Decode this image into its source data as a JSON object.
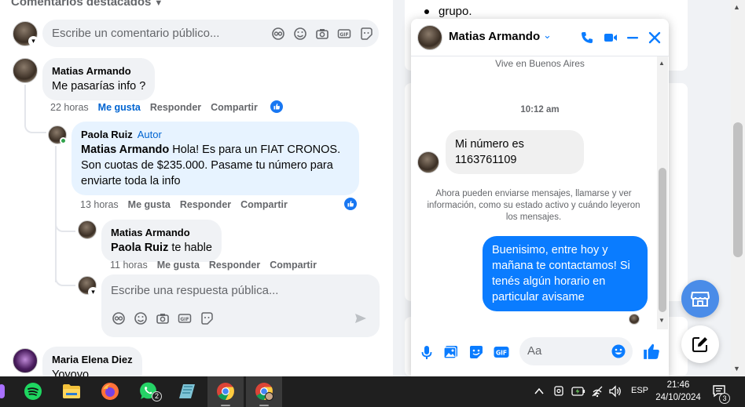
{
  "post": {
    "filter_label": "Comentarios destacados",
    "comment_input_placeholder": "Escribe un comentario público...",
    "reply_input_placeholder": "Escribe una respuesta pública..."
  },
  "comments": [
    {
      "author": "Matias Armando",
      "text": "Me pasarías info ?",
      "time": "22 horas",
      "like": "Me gusta",
      "reply": "Responder",
      "share": "Compartir"
    },
    {
      "author": "Paola Ruiz",
      "badge": "Autor",
      "mention": "Matias Armando",
      "text": " Hola! Es para un FIAT CRONOS. Son cuotas de $235.000. Pasame tu número para enviarte toda la info",
      "time": "13 horas",
      "like": "Me gusta",
      "reply": "Responder",
      "share": "Compartir"
    },
    {
      "author": "Matias Armando",
      "mention": "Paola Ruiz",
      "text": " te hable",
      "time": "11 horas",
      "like": "Me gusta",
      "reply": "Responder",
      "share": "Compartir"
    },
    {
      "author": "Maria Elena Diez",
      "text": "Yoyoyo"
    }
  ],
  "background_card": {
    "text": "grupo."
  },
  "chat": {
    "contact_name": "Matias Armando",
    "location": "Vive en Buenos Aires",
    "timestamp": "10:12 am",
    "incoming_message": "Mi número es 1163761109",
    "system_notice": "Ahora pueden enviarse mensajes, llamarse y ver información, como su estado activo y cuándo leyeron los mensajes.",
    "outgoing_message": "Buenisimo, entre hoy y mañana te contactamos! Si tenés algún horario en particular avisame",
    "input_placeholder": "Aa"
  },
  "taskbar": {
    "apps": [
      "spotify",
      "file-explorer",
      "firefox",
      "whatsapp",
      "notes",
      "chrome",
      "chrome-profile"
    ],
    "whatsapp_badge": "2",
    "language": "ESP",
    "time": "21:46",
    "date": "24/10/2024",
    "notifications": "3"
  },
  "colors": {
    "accent": "#0a7cff",
    "facebook_blue": "#1877f2",
    "author_bubble": "#e7f3ff",
    "taskbar": "#1f1f1f"
  }
}
